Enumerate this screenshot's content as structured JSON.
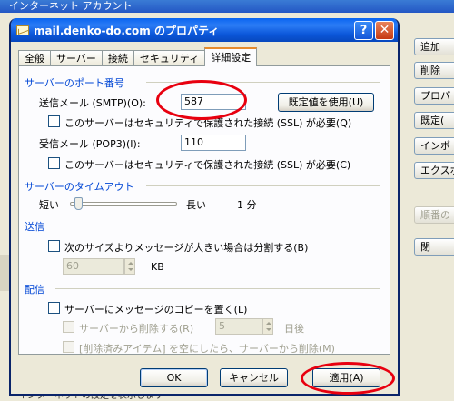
{
  "background": {
    "title": "インターネット アカウント",
    "buttons": [
      "追加",
      "削除",
      "プロパ",
      "既定(",
      "インポ",
      "エクスポ",
      "順番の"
    ],
    "close_label": "閉",
    "bottom_text": "インターネットの設定を表示します"
  },
  "dialog": {
    "title": "mail.denko-do.com のプロパティ",
    "help_label": "?",
    "close_label": "✕",
    "tabs": [
      {
        "label": "全般"
      },
      {
        "label": "サーバー"
      },
      {
        "label": "接続"
      },
      {
        "label": "セキュリティ"
      },
      {
        "label": "詳細設定"
      }
    ],
    "active_tab": "詳細設定",
    "port_section": {
      "title": "サーバーのポート番号",
      "smtp_label": "送信メール (SMTP)(O):",
      "smtp_value": "587",
      "default_button": "既定値を使用(U)",
      "smtp_ssl_label": "このサーバーはセキュリティで保護された接続 (SSL) が必要(Q)",
      "pop3_label": "受信メール (POP3)(I):",
      "pop3_value": "110",
      "pop3_ssl_label": "このサーバーはセキュリティで保護された接続 (SSL) が必要(C)"
    },
    "timeout_section": {
      "title": "サーバーのタイムアウト",
      "short_label": "短い",
      "long_label": "長い",
      "value_label": "1 分",
      "level": 0.05
    },
    "send_section": {
      "title": "送信",
      "split_label": "次のサイズよりメッセージが大きい場合は分割する(B)",
      "size_value": "60",
      "size_unit": "KB"
    },
    "delivery_section": {
      "title": "配信",
      "copy_label": "サーバーにメッセージのコピーを置く(L)",
      "remove_label": "サーバーから削除する(R)",
      "days_value": "5",
      "days_unit": "日後",
      "trash_label": "[削除済みアイテム] を空にしたら、サーバーから削除(M)"
    },
    "buttons": {
      "ok": "OK",
      "cancel": "キャンセル",
      "apply": "適用(A)"
    },
    "highlight_color": "#e8000f"
  }
}
